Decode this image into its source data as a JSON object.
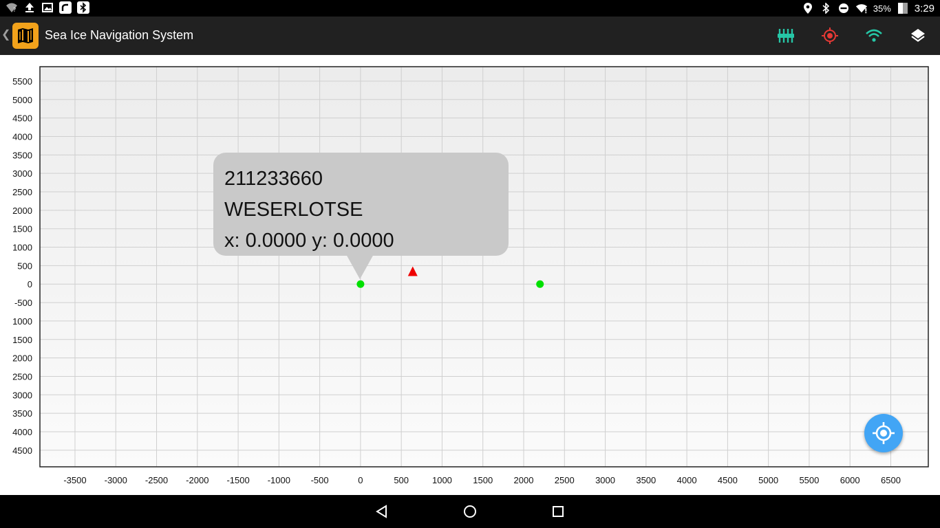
{
  "status_bar": {
    "left_icons": [
      "wifi-unknown-icon",
      "upload-icon",
      "image-icon",
      "app-notification-icon",
      "bluetooth-notification-icon"
    ],
    "right_icons": [
      "location-icon",
      "bluetooth-icon",
      "do-not-disturb-icon",
      "wifi-signal-icon"
    ],
    "battery": "35%",
    "time": "3:29"
  },
  "app_bar": {
    "title": "Sea Ice Navigation System",
    "actions": [
      "equalizer-icon",
      "target-icon",
      "wifi-icon",
      "layers-icon"
    ],
    "colors": {
      "equalizer": "#26c6a6",
      "target": "#e53935",
      "wifi": "#26c6a6",
      "layers": "#ffffff"
    }
  },
  "chart_data": {
    "type": "scatter",
    "x_ticks": [
      "-3500",
      "-3000",
      "-2500",
      "-2000",
      "-1500",
      "-1000",
      "-500",
      "0",
      "500",
      "1000",
      "1500",
      "2000",
      "2500",
      "3000",
      "3500",
      "4000",
      "4500",
      "5000",
      "5500",
      "6000",
      "6500"
    ],
    "y_ticks": [
      "5500",
      "5000",
      "4500",
      "4000",
      "3500",
      "3000",
      "2500",
      "2000",
      "1500",
      "1000",
      "500",
      "0",
      "-500",
      "1000",
      "1500",
      "2000",
      "2500",
      "3000",
      "3500",
      "4000",
      "4500"
    ],
    "xlim": [
      -3930,
      6960
    ],
    "ylim": [
      -4950,
      5890
    ],
    "grid": true,
    "points": [
      {
        "x": 0,
        "y": 0,
        "marker": "circle",
        "color": "#00e000"
      },
      {
        "x": 2200,
        "y": 0,
        "marker": "circle",
        "color": "#00e000"
      },
      {
        "x": 640,
        "y": 330,
        "marker": "triangle",
        "color": "#ee0000"
      }
    ]
  },
  "callout": {
    "id": "211233660",
    "name": "WESERLOTSE",
    "coords": "x: 0.0000 y: 0.0000"
  },
  "fab": {
    "icon": "my-location-icon",
    "color": "#42a5f5"
  },
  "nav_bar": {
    "buttons": [
      "back-icon",
      "home-icon",
      "recents-icon"
    ]
  }
}
